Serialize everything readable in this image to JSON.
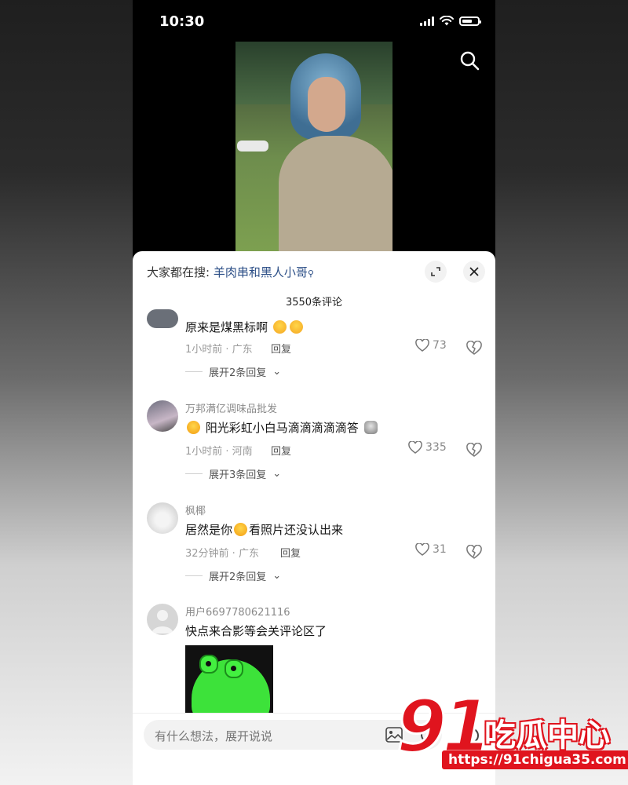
{
  "status_bar": {
    "time": "10:30"
  },
  "hot_search": {
    "prefix": "大家都在搜: ",
    "keyword": "羊肉串和黑人小哥"
  },
  "comment_count": "3550条评论",
  "comments": [
    {
      "username": "",
      "text": "原来是煤黑标啊",
      "emojis": [
        "smug-emoji",
        "smug-emoji"
      ],
      "time": "1小时前 · 广东",
      "reply": "回复",
      "likes": "73",
      "expand": "展开2条回复"
    },
    {
      "username": "万邦满亿调味品批发",
      "text": "阳光彩虹小白马滴滴滴滴滴答",
      "emojis": [
        "laugh-cry-emoji",
        "doge-emoji"
      ],
      "time": "1小时前 · 河南",
      "reply": "回复",
      "likes": "335",
      "expand": "展开3条回复"
    },
    {
      "username": "枫椰",
      "text_before": "居然是你",
      "text_after": "看照片还没认出来",
      "emojis": [
        "laugh-cry-emoji"
      ],
      "time": "32分钟前 · 广东",
      "reply": "回复",
      "likes": "31",
      "expand": "展开2条回复"
    },
    {
      "username": "用户6697780621116",
      "text": "快点来合影等会关评论区了",
      "sticker": "frog-sticker"
    }
  ],
  "input": {
    "placeholder": "有什么想法，展开说说"
  },
  "watermark": {
    "number": "91",
    "title": "吃瓜中心",
    "url": "https://91chigua35.com"
  },
  "colors": {
    "accent_link": "#2b4e86",
    "watermark_red": "#e0141e",
    "sheet_bg": "#ffffff"
  }
}
